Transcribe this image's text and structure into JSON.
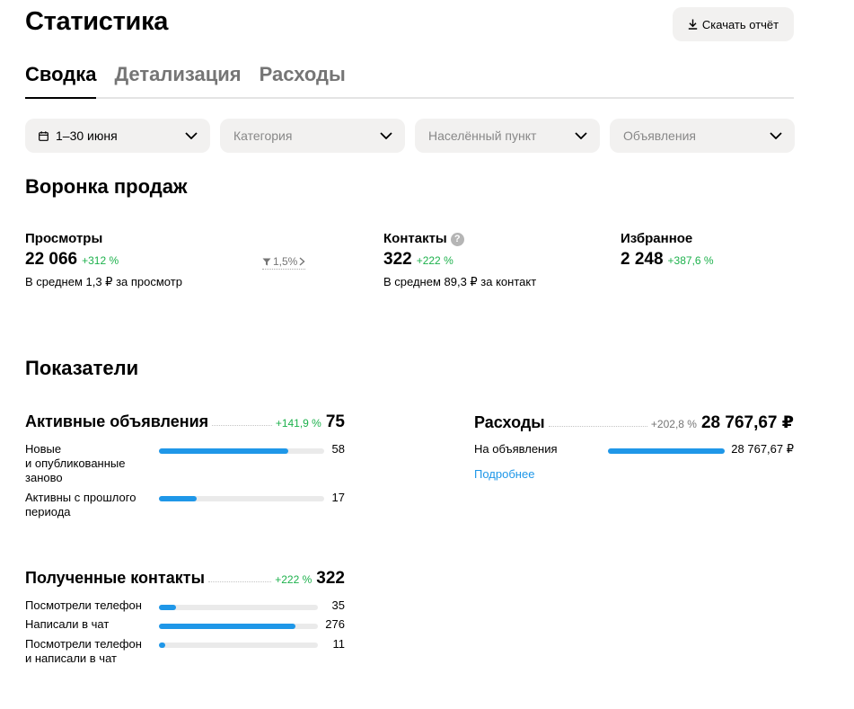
{
  "header": {
    "title": "Статистика",
    "download_label": "Скачать отчёт"
  },
  "tabs": [
    {
      "label": "Сводка",
      "active": true
    },
    {
      "label": "Детализация",
      "active": false
    },
    {
      "label": "Расходы",
      "active": false
    }
  ],
  "filters": {
    "period": "1–30 июня",
    "category": "Категория",
    "city": "Населённый пункт",
    "ads": "Объявления"
  },
  "funnel": {
    "title": "Воронка продаж",
    "views": {
      "label": "Просмотры",
      "value": "22 066",
      "delta": "+312 %",
      "sub": "В среднем 1,3 ₽ за просмотр"
    },
    "conversion": "1,5%",
    "contacts": {
      "label": "Контакты",
      "help": "?",
      "value": "322",
      "delta": "+222 %",
      "sub": "В среднем 89,3 ₽ за контакт"
    },
    "favorites": {
      "label": "Избранное",
      "value": "2 248",
      "delta": "+387,6 %"
    }
  },
  "indicators": {
    "title": "Показатели",
    "active_ads": {
      "title": "Активные объявления",
      "delta": "+141,9 %",
      "total": "75",
      "rows": [
        {
          "label": "Новые\nи опубликованные\nзаново",
          "value": "58",
          "fraction": 0.78
        },
        {
          "label": "Активны с прошлого\nпериода",
          "value": "17",
          "fraction": 0.23
        }
      ]
    },
    "expenses": {
      "title": "Расходы",
      "delta": "+202,8 %",
      "total": "28 767,67 ₽",
      "rows": [
        {
          "label": "На объявления",
          "value": "28 767,67 ₽",
          "fraction": 1.0
        }
      ],
      "more_link": "Подробнее"
    },
    "contacts": {
      "title": "Полученные контакты",
      "delta": "+222 %",
      "total": "322",
      "rows": [
        {
          "label": "Посмотрели телефон",
          "value": "35",
          "fraction": 0.11
        },
        {
          "label": "Написали в чат",
          "value": "276",
          "fraction": 0.86
        },
        {
          "label": "Посмотрели телефон\nи написали в чат",
          "value": "11",
          "fraction": 0.04
        }
      ]
    }
  },
  "colors": {
    "accent_blue": "#1f97e8",
    "positive_green": "#1db14c",
    "muted_gray": "#757575",
    "control_bg": "#f2f1f0"
  },
  "icons": {
    "download": "download-icon",
    "calendar": "calendar-icon",
    "chevron": "chevron-down-icon",
    "help": "help-icon",
    "funnel": "funnel-icon",
    "chevron_right": "chevron-right-icon"
  }
}
